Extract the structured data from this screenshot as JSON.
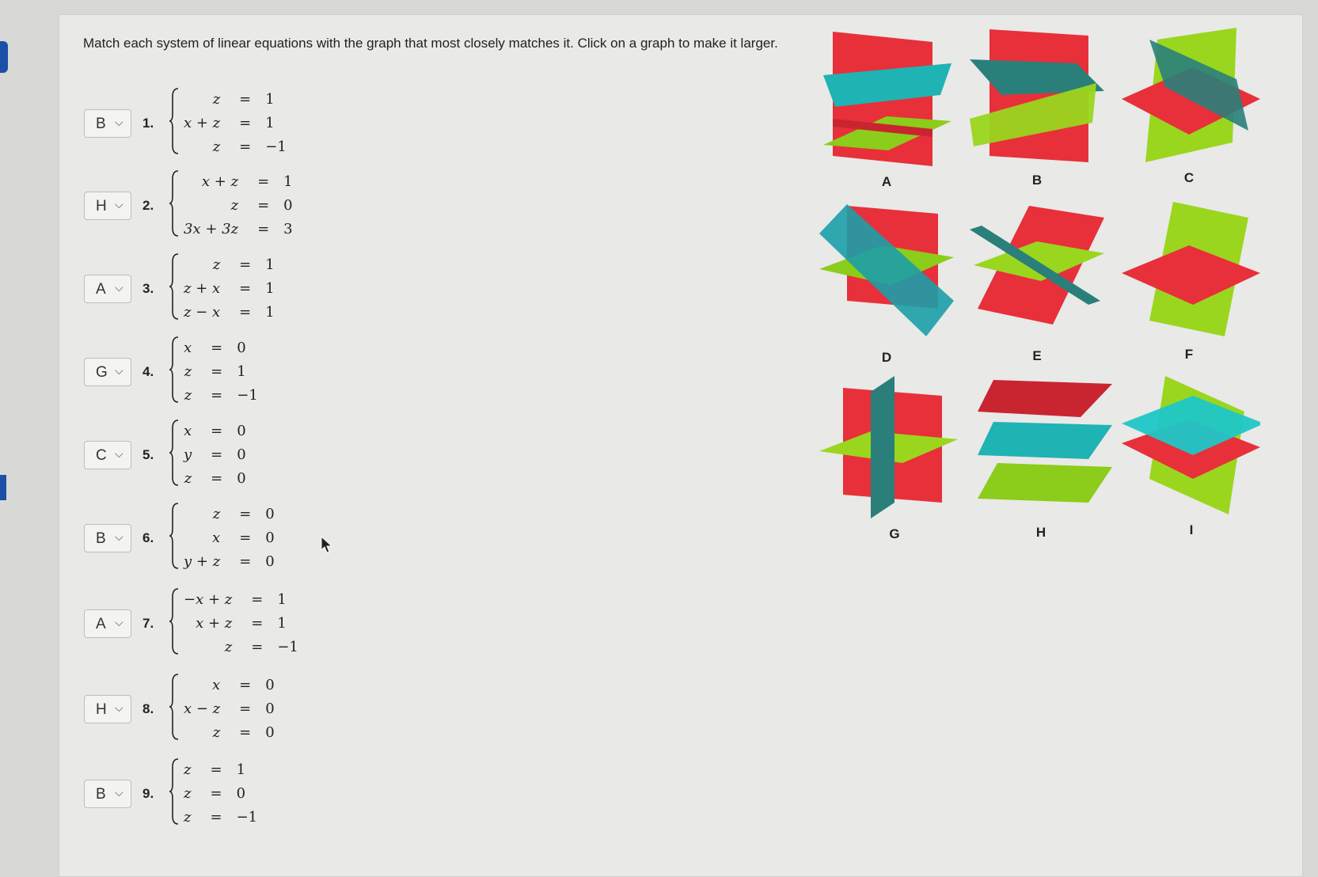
{
  "instructions": "Match each system of linear equations with the graph that most closely matches it. Click on a graph to make it larger.",
  "problems": [
    {
      "num": "1.",
      "answer": "B",
      "rows": [
        {
          "l": "z",
          "r": "1"
        },
        {
          "l": "x + z",
          "r": "1"
        },
        {
          "l": "z",
          "r": "−1"
        }
      ]
    },
    {
      "num": "2.",
      "answer": "H",
      "rows": [
        {
          "l": "x + z",
          "r": "1"
        },
        {
          "l": "z",
          "r": "0"
        },
        {
          "l": "3x + 3z",
          "r": "3"
        }
      ]
    },
    {
      "num": "3.",
      "answer": "A",
      "rows": [
        {
          "l": "z",
          "r": "1"
        },
        {
          "l": "z + x",
          "r": "1"
        },
        {
          "l": "z − x",
          "r": "1"
        }
      ]
    },
    {
      "num": "4.",
      "answer": "G",
      "rows": [
        {
          "l": "x",
          "r": "0"
        },
        {
          "l": "z",
          "r": "1"
        },
        {
          "l": "z",
          "r": "−1"
        }
      ]
    },
    {
      "num": "5.",
      "answer": "C",
      "rows": [
        {
          "l": "x",
          "r": "0"
        },
        {
          "l": "y",
          "r": "0"
        },
        {
          "l": "z",
          "r": "0"
        }
      ]
    },
    {
      "num": "6.",
      "answer": "B",
      "rows": [
        {
          "l": "z",
          "r": "0"
        },
        {
          "l": "x",
          "r": "0"
        },
        {
          "l": "y + z",
          "r": "0"
        }
      ]
    },
    {
      "num": "7.",
      "answer": "A",
      "rows": [
        {
          "l": "−x + z",
          "r": "1"
        },
        {
          "l": "x + z",
          "r": "1"
        },
        {
          "l": "z",
          "r": "−1"
        }
      ]
    },
    {
      "num": "8.",
      "answer": "H",
      "rows": [
        {
          "l": "x",
          "r": "0"
        },
        {
          "l": "x − z",
          "r": "0"
        },
        {
          "l": "z",
          "r": "0"
        }
      ]
    },
    {
      "num": "9.",
      "answer": "B",
      "rows": [
        {
          "l": "z",
          "r": "1"
        },
        {
          "l": "z",
          "r": "0"
        },
        {
          "l": "z",
          "r": "−1"
        }
      ]
    }
  ],
  "equals_sign": "=",
  "graphs": [
    {
      "label": "A"
    },
    {
      "label": "B"
    },
    {
      "label": "C"
    },
    {
      "label": "D"
    },
    {
      "label": "E"
    },
    {
      "label": "F"
    },
    {
      "label": "G"
    },
    {
      "label": "H"
    },
    {
      "label": "I"
    }
  ],
  "colors": {
    "red": "#e8303a",
    "green": "#9ad61e",
    "teal": "#1fb3b3",
    "dark_teal": "#2a7f7a"
  }
}
